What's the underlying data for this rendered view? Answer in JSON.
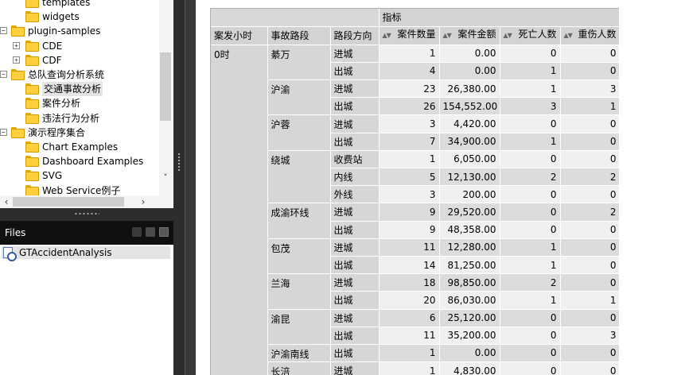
{
  "tree": {
    "items": [
      {
        "label": "templates",
        "expander": "",
        "folder": true,
        "indent": 1
      },
      {
        "label": "widgets",
        "expander": "",
        "folder": true,
        "indent": 1
      },
      {
        "label": "plugin-samples",
        "expander": "−",
        "folder": true,
        "indent": 0
      },
      {
        "label": "CDE",
        "expander": "+",
        "folder": true,
        "indent": 1
      },
      {
        "label": "CDF",
        "expander": "+",
        "folder": true,
        "indent": 1
      },
      {
        "label": "总队查询分析系统",
        "expander": "−",
        "folder": true,
        "indent": 0
      },
      {
        "label": "交通事故分析",
        "expander": "",
        "folder": true,
        "indent": 1,
        "selected": true
      },
      {
        "label": "案件分析",
        "expander": "",
        "folder": true,
        "indent": 1
      },
      {
        "label": "违法行为分析",
        "expander": "",
        "folder": true,
        "indent": 1
      },
      {
        "label": "演示程序集合",
        "expander": "−",
        "folder": true,
        "indent": 0
      },
      {
        "label": "Chart Examples",
        "expander": "",
        "folder": true,
        "indent": 1
      },
      {
        "label": "Dashboard Examples",
        "expander": "",
        "folder": true,
        "indent": 1
      },
      {
        "label": "SVG",
        "expander": "",
        "folder": true,
        "indent": 1
      },
      {
        "label": "Web Service例子",
        "expander": "",
        "folder": true,
        "indent": 1
      }
    ],
    "scroll_up": "˄",
    "scroll_down": "˅",
    "scroll_left": "‹",
    "scroll_right": "›"
  },
  "files": {
    "title": "Files",
    "items": [
      "GTAccidentAnalysis"
    ]
  },
  "pivot": {
    "measures_label": "指标",
    "row_headers": [
      "案发小时",
      "事故路段",
      "路段方向"
    ],
    "measures": [
      "案件数量",
      "案件金额",
      "死亡人数",
      "重伤人数"
    ],
    "hour": "0时",
    "roads": [
      {
        "name": "綦万",
        "rows": [
          {
            "dir": "进城",
            "count": "1",
            "amount": "0.00",
            "deaths": "0",
            "injuries": "0"
          },
          {
            "dir": "出城",
            "count": "4",
            "amount": "0.00",
            "deaths": "1",
            "injuries": "0"
          }
        ]
      },
      {
        "name": "沪渝",
        "rows": [
          {
            "dir": "进城",
            "count": "23",
            "amount": "26,380.00",
            "deaths": "1",
            "injuries": "3"
          },
          {
            "dir": "出城",
            "count": "26",
            "amount": "154,552.00",
            "deaths": "3",
            "injuries": "1"
          }
        ]
      },
      {
        "name": "沪蓉",
        "rows": [
          {
            "dir": "进城",
            "count": "3",
            "amount": "4,420.00",
            "deaths": "0",
            "injuries": "0"
          },
          {
            "dir": "出城",
            "count": "7",
            "amount": "34,900.00",
            "deaths": "1",
            "injuries": "0"
          }
        ]
      },
      {
        "name": "绕城",
        "rows": [
          {
            "dir": "收费站",
            "count": "1",
            "amount": "6,050.00",
            "deaths": "0",
            "injuries": "0"
          },
          {
            "dir": "内线",
            "count": "5",
            "amount": "12,130.00",
            "deaths": "2",
            "injuries": "2"
          },
          {
            "dir": "外线",
            "count": "3",
            "amount": "200.00",
            "deaths": "0",
            "injuries": "0"
          }
        ]
      },
      {
        "name": "成渝环线",
        "rows": [
          {
            "dir": "进城",
            "count": "9",
            "amount": "29,520.00",
            "deaths": "0",
            "injuries": "2"
          },
          {
            "dir": "出城",
            "count": "9",
            "amount": "48,358.00",
            "deaths": "0",
            "injuries": "0"
          }
        ]
      },
      {
        "name": "包茂",
        "rows": [
          {
            "dir": "进城",
            "count": "11",
            "amount": "12,280.00",
            "deaths": "1",
            "injuries": "0"
          },
          {
            "dir": "出城",
            "count": "14",
            "amount": "81,250.00",
            "deaths": "1",
            "injuries": "0"
          }
        ]
      },
      {
        "name": "兰海",
        "rows": [
          {
            "dir": "进城",
            "count": "18",
            "amount": "98,850.00",
            "deaths": "2",
            "injuries": "0"
          },
          {
            "dir": "出城",
            "count": "20",
            "amount": "86,030.00",
            "deaths": "1",
            "injuries": "1"
          }
        ]
      },
      {
        "name": "渝昆",
        "rows": [
          {
            "dir": "进城",
            "count": "6",
            "amount": "25,120.00",
            "deaths": "0",
            "injuries": "0"
          },
          {
            "dir": "出城",
            "count": "11",
            "amount": "35,200.00",
            "deaths": "0",
            "injuries": "3"
          }
        ]
      },
      {
        "name": "沪渝南线",
        "rows": [
          {
            "dir": "出城",
            "count": "1",
            "amount": "0.00",
            "deaths": "0",
            "injuries": "0"
          }
        ]
      },
      {
        "name": "长涪",
        "rows": [
          {
            "dir": "进城",
            "count": "1",
            "amount": "4,830.00",
            "deaths": "0",
            "injuries": "0"
          }
        ]
      }
    ]
  }
}
